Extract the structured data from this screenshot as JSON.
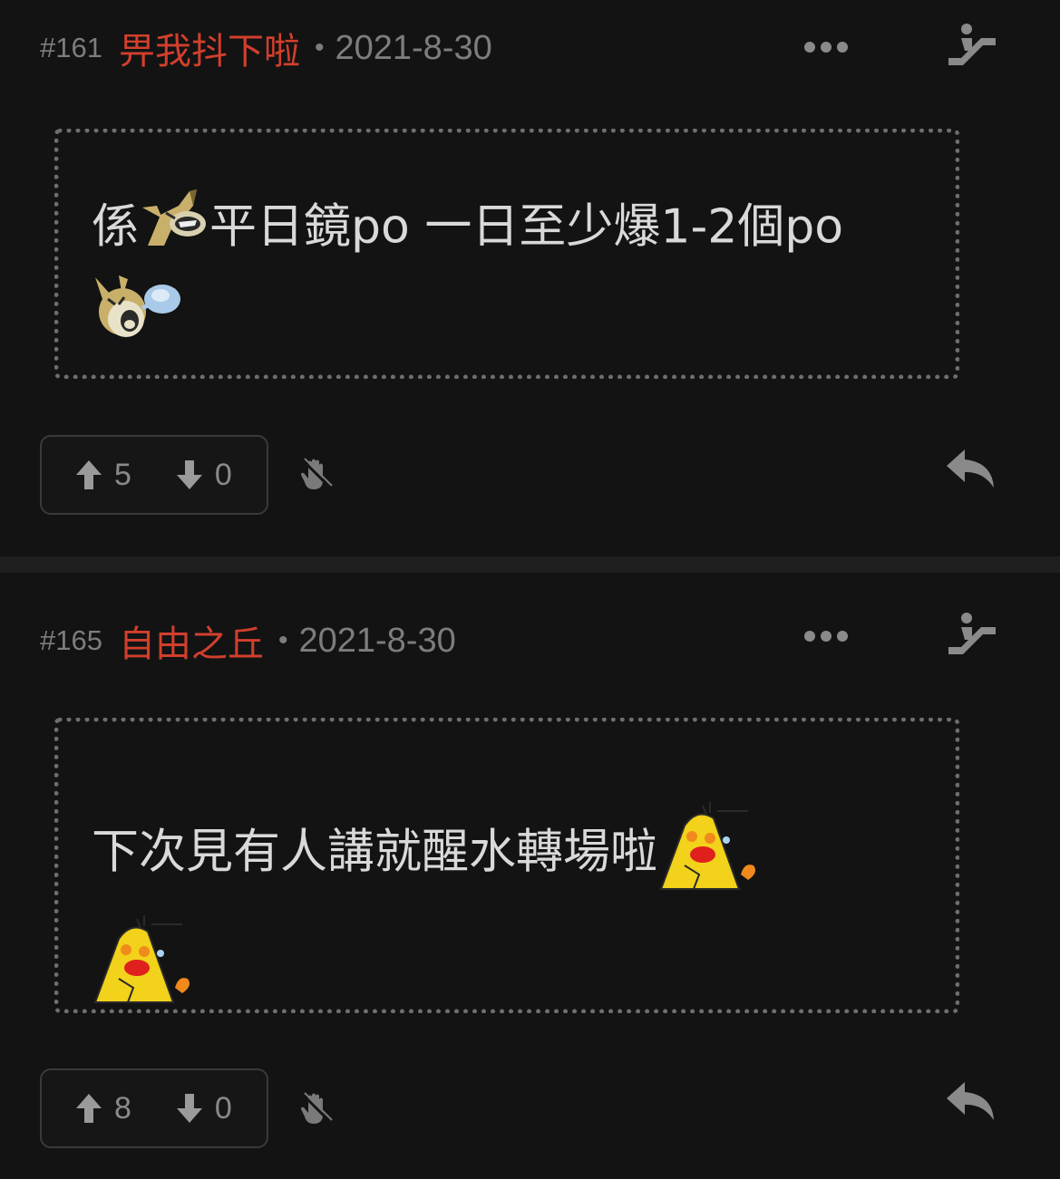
{
  "posts": [
    {
      "floor": "#161",
      "username": "畀我抖下啦",
      "separator": "•",
      "date": "2021-8-30",
      "content_line1_pre": "係",
      "content_line1_post": "平日鏡po 一日至少爆1-2個po",
      "upvotes": "5",
      "downvotes": "0",
      "emoji_icons": [
        "horse-laughing-emoji-icon",
        "horse-sneezing-emoji-icon"
      ]
    },
    {
      "floor": "#165",
      "username": "自由之丘",
      "separator": "•",
      "date": "2021-8-30",
      "content_line1": "下次見有人講就醒水轉場啦",
      "upvotes": "8",
      "downvotes": "0",
      "emoji_icons": [
        "yellow-chick-laughing-emoji-icon",
        "yellow-chick-laughing-emoji-icon"
      ]
    }
  ],
  "colors": {
    "background": "#131313",
    "username": "#d23f2d",
    "meta": "#7d7d7d",
    "text": "#d9d9d9",
    "border": "#6e6e6e"
  }
}
